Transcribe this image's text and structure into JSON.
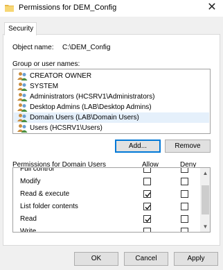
{
  "window": {
    "title": "Permissions for DEM_Config",
    "close_glyph": "✕"
  },
  "tab": {
    "label": "Security"
  },
  "object": {
    "label": "Object name:",
    "value": "C:\\DEM_Config"
  },
  "groups": {
    "label": "Group or user names:",
    "items": [
      {
        "label": "CREATOR OWNER",
        "selected": false
      },
      {
        "label": "SYSTEM",
        "selected": false
      },
      {
        "label": "Administrators (HCSRV1\\Administrators)",
        "selected": false
      },
      {
        "label": "Desktop Admins (LAB\\Desktop Admins)",
        "selected": false
      },
      {
        "label": "Domain Users (LAB\\Domain Users)",
        "selected": true
      },
      {
        "label": "Users (HCSRV1\\Users)",
        "selected": false
      }
    ]
  },
  "buttons": {
    "add": "Add...",
    "remove": "Remove"
  },
  "permissions": {
    "header": "Permissions for Domain Users",
    "allow_header": "Allow",
    "deny_header": "Deny",
    "rows": [
      {
        "name": "Full control",
        "allow": false,
        "deny": false
      },
      {
        "name": "Modify",
        "allow": false,
        "deny": false
      },
      {
        "name": "Read & execute",
        "allow": true,
        "deny": false
      },
      {
        "name": "List folder contents",
        "allow": true,
        "deny": false
      },
      {
        "name": "Read",
        "allow": true,
        "deny": false
      },
      {
        "name": "Write",
        "allow": false,
        "deny": false
      }
    ]
  },
  "footer": {
    "ok": "OK",
    "cancel": "Cancel",
    "apply": "Apply"
  },
  "colors": {
    "accent": "#0078d7",
    "selection": "#e5f0fb",
    "check": "#000000"
  }
}
